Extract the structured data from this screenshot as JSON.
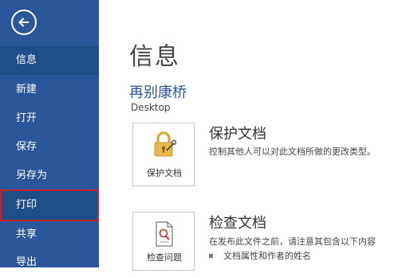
{
  "sidebar": {
    "items": [
      {
        "label": "信息"
      },
      {
        "label": "新建"
      },
      {
        "label": "打开"
      },
      {
        "label": "保存"
      },
      {
        "label": "另存为"
      },
      {
        "label": "打印"
      },
      {
        "label": "共享"
      },
      {
        "label": "导出"
      }
    ],
    "active_item": "信息",
    "highlighted_item": "打印"
  },
  "main": {
    "title": "信息",
    "document_name": "再别康桥",
    "document_path": "Desktop",
    "protect": {
      "button_label": "保护文档",
      "icon": "lock-key-icon",
      "title": "保护文档",
      "description": "控制其他人可以对此文档所做的更改类型。"
    },
    "inspect": {
      "button_label": "检查问题",
      "icon": "inspect-document-icon",
      "title": "检查文档",
      "description": "在发布此文件之前，请注意其包含以下内容",
      "bullets": [
        "文档属性和作者的姓名"
      ]
    }
  },
  "colors": {
    "sidebar_bg": "#2b579a",
    "sidebar_active": "#1f4e88",
    "highlight_border": "#c5222a",
    "accent_text": "#2b579a"
  }
}
